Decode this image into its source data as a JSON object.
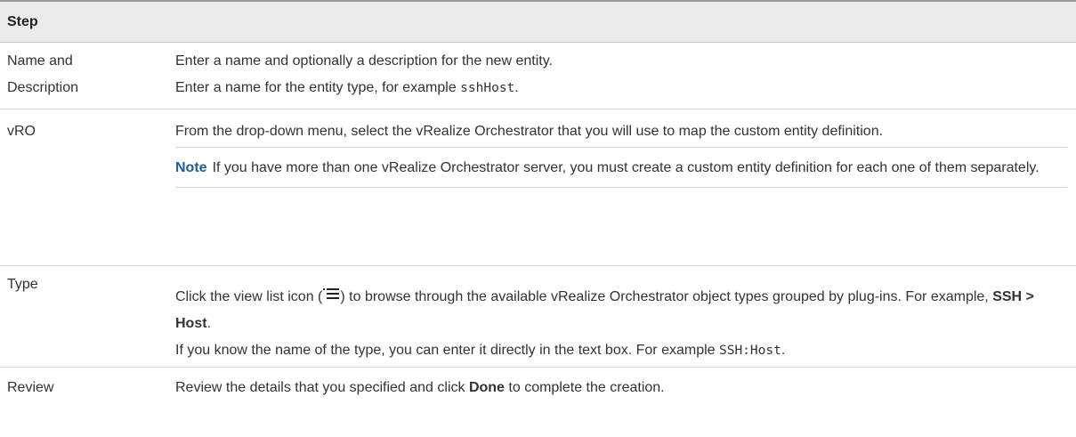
{
  "header": {
    "step_label": "Step"
  },
  "rows": {
    "name": {
      "step": "Name and Description",
      "p1": "Enter a name and optionally a description for the new entity.",
      "p2_before": "Enter a name for the entity type, for example ",
      "p2_code": "sshHost",
      "p2_after": "."
    },
    "vro": {
      "step": "vRO",
      "p1": "From the drop-down menu, select the vRealize Orchestrator that you will use to map the custom entity definition.",
      "note_label": "Note",
      "note_text": "If you have more than one vRealize Orchestrator server, you must create a custom entity definition for each one of them separately."
    },
    "type": {
      "step": "Type",
      "p1_before": "Click the view list icon (",
      "p1_after": ") to browse through the available vRealize Orchestrator object types grouped by plug-ins. For example, ",
      "p1_bold": "SSH > Host",
      "p1_end": ".",
      "p2_before": "If you know the name of the type, you can enter it directly in the text box. For example ",
      "p2_code": "SSH:Host",
      "p2_after": "."
    },
    "review": {
      "step": "Review",
      "p1_before": "Review the details that you specified and click ",
      "p1_bold": "Done",
      "p1_after": " to complete the creation."
    }
  }
}
